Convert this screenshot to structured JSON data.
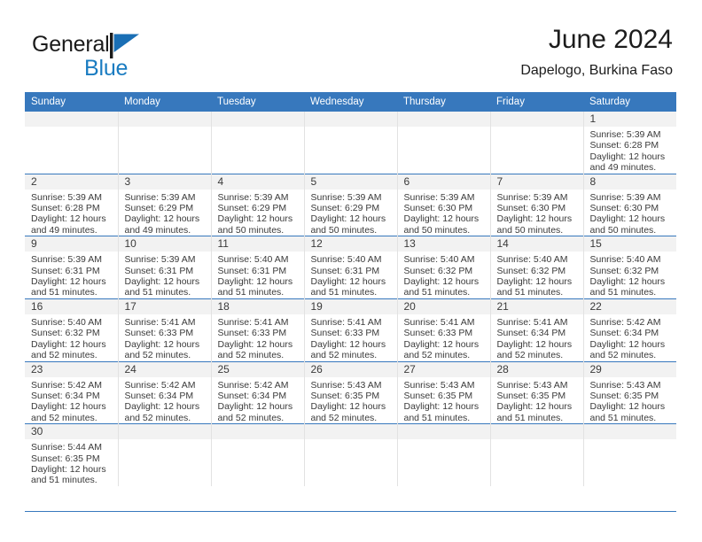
{
  "brand": {
    "name_part1": "General",
    "name_part2": "Blue",
    "logo_icon": "blue-flag-triangle"
  },
  "header": {
    "title": "June 2024",
    "subtitle": "Dapelogo, Burkina Faso"
  },
  "theme": {
    "header_blue": "#3778bd",
    "brand_blue": "#1a7cc1",
    "daynum_band": "#f2f2f2",
    "text": "#3a3a3a"
  },
  "weekday_headers": [
    "Sunday",
    "Monday",
    "Tuesday",
    "Wednesday",
    "Thursday",
    "Friday",
    "Saturday"
  ],
  "labels": {
    "sunrise": "Sunrise:",
    "sunset": "Sunset:",
    "daylight": "Daylight:"
  },
  "weeks": [
    [
      {
        "day": "",
        "line1": "",
        "line2": "",
        "line3": "",
        "line4": ""
      },
      {
        "day": "",
        "line1": "",
        "line2": "",
        "line3": "",
        "line4": ""
      },
      {
        "day": "",
        "line1": "",
        "line2": "",
        "line3": "",
        "line4": ""
      },
      {
        "day": "",
        "line1": "",
        "line2": "",
        "line3": "",
        "line4": ""
      },
      {
        "day": "",
        "line1": "",
        "line2": "",
        "line3": "",
        "line4": ""
      },
      {
        "day": "",
        "line1": "",
        "line2": "",
        "line3": "",
        "line4": ""
      },
      {
        "day": "1",
        "line1": "Sunrise: 5:39 AM",
        "line2": "Sunset: 6:28 PM",
        "line3": "Daylight: 12 hours",
        "line4": "and 49 minutes."
      }
    ],
    [
      {
        "day": "2",
        "line1": "Sunrise: 5:39 AM",
        "line2": "Sunset: 6:28 PM",
        "line3": "Daylight: 12 hours",
        "line4": "and 49 minutes."
      },
      {
        "day": "3",
        "line1": "Sunrise: 5:39 AM",
        "line2": "Sunset: 6:29 PM",
        "line3": "Daylight: 12 hours",
        "line4": "and 49 minutes."
      },
      {
        "day": "4",
        "line1": "Sunrise: 5:39 AM",
        "line2": "Sunset: 6:29 PM",
        "line3": "Daylight: 12 hours",
        "line4": "and 50 minutes."
      },
      {
        "day": "5",
        "line1": "Sunrise: 5:39 AM",
        "line2": "Sunset: 6:29 PM",
        "line3": "Daylight: 12 hours",
        "line4": "and 50 minutes."
      },
      {
        "day": "6",
        "line1": "Sunrise: 5:39 AM",
        "line2": "Sunset: 6:30 PM",
        "line3": "Daylight: 12 hours",
        "line4": "and 50 minutes."
      },
      {
        "day": "7",
        "line1": "Sunrise: 5:39 AM",
        "line2": "Sunset: 6:30 PM",
        "line3": "Daylight: 12 hours",
        "line4": "and 50 minutes."
      },
      {
        "day": "8",
        "line1": "Sunrise: 5:39 AM",
        "line2": "Sunset: 6:30 PM",
        "line3": "Daylight: 12 hours",
        "line4": "and 50 minutes."
      }
    ],
    [
      {
        "day": "9",
        "line1": "Sunrise: 5:39 AM",
        "line2": "Sunset: 6:31 PM",
        "line3": "Daylight: 12 hours",
        "line4": "and 51 minutes."
      },
      {
        "day": "10",
        "line1": "Sunrise: 5:39 AM",
        "line2": "Sunset: 6:31 PM",
        "line3": "Daylight: 12 hours",
        "line4": "and 51 minutes."
      },
      {
        "day": "11",
        "line1": "Sunrise: 5:40 AM",
        "line2": "Sunset: 6:31 PM",
        "line3": "Daylight: 12 hours",
        "line4": "and 51 minutes."
      },
      {
        "day": "12",
        "line1": "Sunrise: 5:40 AM",
        "line2": "Sunset: 6:31 PM",
        "line3": "Daylight: 12 hours",
        "line4": "and 51 minutes."
      },
      {
        "day": "13",
        "line1": "Sunrise: 5:40 AM",
        "line2": "Sunset: 6:32 PM",
        "line3": "Daylight: 12 hours",
        "line4": "and 51 minutes."
      },
      {
        "day": "14",
        "line1": "Sunrise: 5:40 AM",
        "line2": "Sunset: 6:32 PM",
        "line3": "Daylight: 12 hours",
        "line4": "and 51 minutes."
      },
      {
        "day": "15",
        "line1": "Sunrise: 5:40 AM",
        "line2": "Sunset: 6:32 PM",
        "line3": "Daylight: 12 hours",
        "line4": "and 51 minutes."
      }
    ],
    [
      {
        "day": "16",
        "line1": "Sunrise: 5:40 AM",
        "line2": "Sunset: 6:32 PM",
        "line3": "Daylight: 12 hours",
        "line4": "and 52 minutes."
      },
      {
        "day": "17",
        "line1": "Sunrise: 5:41 AM",
        "line2": "Sunset: 6:33 PM",
        "line3": "Daylight: 12 hours",
        "line4": "and 52 minutes."
      },
      {
        "day": "18",
        "line1": "Sunrise: 5:41 AM",
        "line2": "Sunset: 6:33 PM",
        "line3": "Daylight: 12 hours",
        "line4": "and 52 minutes."
      },
      {
        "day": "19",
        "line1": "Sunrise: 5:41 AM",
        "line2": "Sunset: 6:33 PM",
        "line3": "Daylight: 12 hours",
        "line4": "and 52 minutes."
      },
      {
        "day": "20",
        "line1": "Sunrise: 5:41 AM",
        "line2": "Sunset: 6:33 PM",
        "line3": "Daylight: 12 hours",
        "line4": "and 52 minutes."
      },
      {
        "day": "21",
        "line1": "Sunrise: 5:41 AM",
        "line2": "Sunset: 6:34 PM",
        "line3": "Daylight: 12 hours",
        "line4": "and 52 minutes."
      },
      {
        "day": "22",
        "line1": "Sunrise: 5:42 AM",
        "line2": "Sunset: 6:34 PM",
        "line3": "Daylight: 12 hours",
        "line4": "and 52 minutes."
      }
    ],
    [
      {
        "day": "23",
        "line1": "Sunrise: 5:42 AM",
        "line2": "Sunset: 6:34 PM",
        "line3": "Daylight: 12 hours",
        "line4": "and 52 minutes."
      },
      {
        "day": "24",
        "line1": "Sunrise: 5:42 AM",
        "line2": "Sunset: 6:34 PM",
        "line3": "Daylight: 12 hours",
        "line4": "and 52 minutes."
      },
      {
        "day": "25",
        "line1": "Sunrise: 5:42 AM",
        "line2": "Sunset: 6:34 PM",
        "line3": "Daylight: 12 hours",
        "line4": "and 52 minutes."
      },
      {
        "day": "26",
        "line1": "Sunrise: 5:43 AM",
        "line2": "Sunset: 6:35 PM",
        "line3": "Daylight: 12 hours",
        "line4": "and 52 minutes."
      },
      {
        "day": "27",
        "line1": "Sunrise: 5:43 AM",
        "line2": "Sunset: 6:35 PM",
        "line3": "Daylight: 12 hours",
        "line4": "and 51 minutes."
      },
      {
        "day": "28",
        "line1": "Sunrise: 5:43 AM",
        "line2": "Sunset: 6:35 PM",
        "line3": "Daylight: 12 hours",
        "line4": "and 51 minutes."
      },
      {
        "day": "29",
        "line1": "Sunrise: 5:43 AM",
        "line2": "Sunset: 6:35 PM",
        "line3": "Daylight: 12 hours",
        "line4": "and 51 minutes."
      }
    ],
    [
      {
        "day": "30",
        "line1": "Sunrise: 5:44 AM",
        "line2": "Sunset: 6:35 PM",
        "line3": "Daylight: 12 hours",
        "line4": "and 51 minutes."
      },
      {
        "day": "",
        "line1": "",
        "line2": "",
        "line3": "",
        "line4": ""
      },
      {
        "day": "",
        "line1": "",
        "line2": "",
        "line3": "",
        "line4": ""
      },
      {
        "day": "",
        "line1": "",
        "line2": "",
        "line3": "",
        "line4": ""
      },
      {
        "day": "",
        "line1": "",
        "line2": "",
        "line3": "",
        "line4": ""
      },
      {
        "day": "",
        "line1": "",
        "line2": "",
        "line3": "",
        "line4": ""
      },
      {
        "day": "",
        "line1": "",
        "line2": "",
        "line3": "",
        "line4": ""
      }
    ]
  ]
}
